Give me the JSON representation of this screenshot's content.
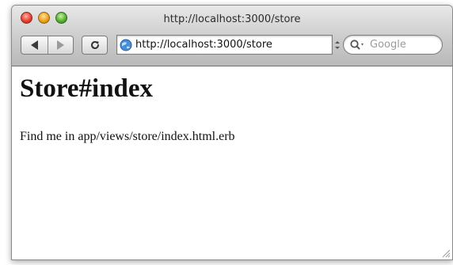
{
  "window": {
    "title": "http://localhost:3000/store"
  },
  "toolbar": {
    "url": "http://localhost:3000/store",
    "search_placeholder": "Google",
    "icons": {
      "back": "back-arrow-icon",
      "forward": "forward-arrow-icon",
      "reload": "reload-icon",
      "site": "globe-icon",
      "search": "search-icon"
    }
  },
  "page": {
    "heading": "Store#index",
    "paragraph": "Find me in app/views/store/index.html.erb"
  },
  "colors": {
    "close": "#e8402f",
    "minimize": "#f0a21c",
    "zoom": "#58b32f"
  }
}
